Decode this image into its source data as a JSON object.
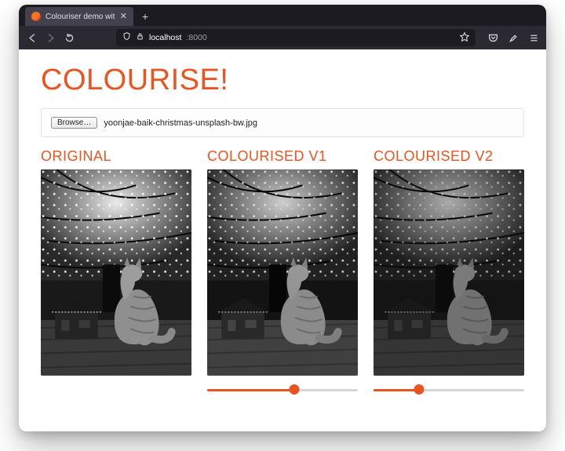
{
  "browser": {
    "tab_title": "Colouriser demo with OpenVIN",
    "new_tab_glyph": "+",
    "close_tab_glyph": "✕",
    "url_host": "localhost",
    "url_port": ":8000"
  },
  "icons": {
    "back": "back-icon",
    "forward": "forward-icon",
    "reload": "reload-icon",
    "shield": "shield-icon",
    "lock": "lock-icon",
    "star": "star-icon",
    "pocket": "pocket-icon",
    "extension": "extension-icon",
    "menu": "menu-icon"
  },
  "page": {
    "title": "COLOURISE!",
    "browse_button": "Browse…",
    "selected_filename": "yoonjae-baik-christmas-unsplash-bw.jpg",
    "columns": {
      "original": {
        "heading": "ORIGINAL"
      },
      "v1": {
        "heading": "COLOURISED V1",
        "slider_value": 58,
        "slider_max": 100
      },
      "v2": {
        "heading": "COLOURISED V2",
        "slider_value": 30,
        "slider_max": 100
      }
    }
  },
  "colors": {
    "accent": "#e95420",
    "tab_bg": "#42414d",
    "chrome_bg": "#2b2a33"
  }
}
